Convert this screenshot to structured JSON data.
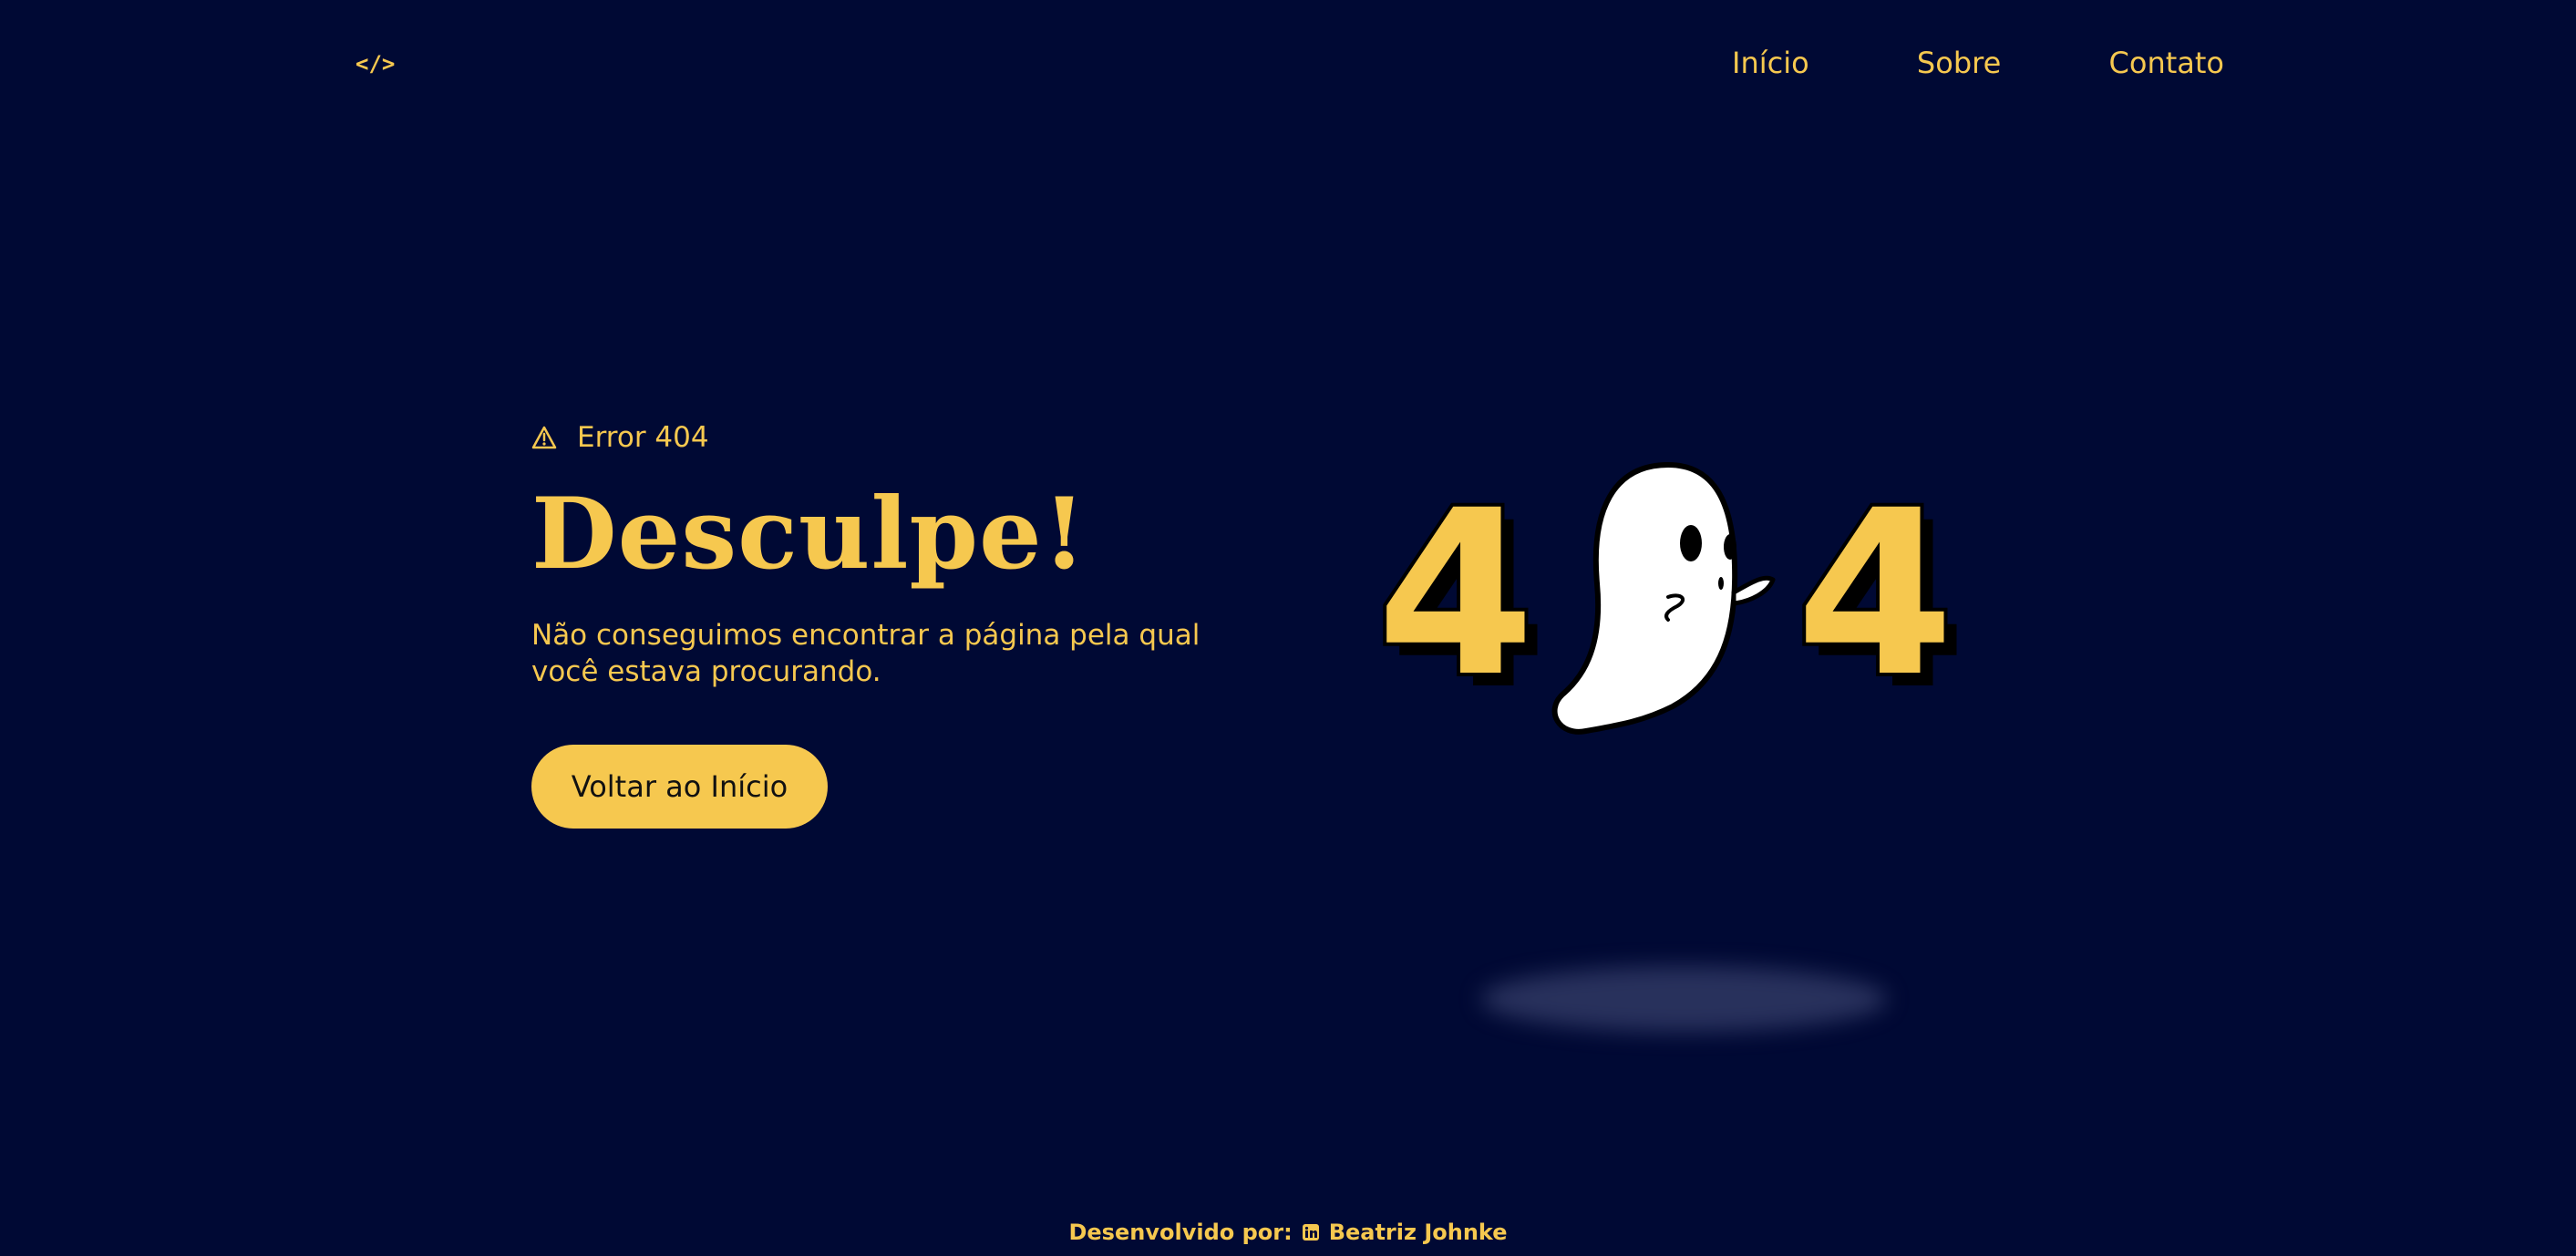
{
  "logo": {
    "text": "</>"
  },
  "nav": {
    "items": [
      "Início",
      "Sobre",
      "Contato"
    ]
  },
  "error": {
    "label": "Error 404"
  },
  "hero": {
    "headline": "Desculpe!",
    "description": "Não conseguimos encontrar a página pela qual você estava procurando.",
    "button": "Voltar ao Início"
  },
  "illustration": {
    "left_digit": "4",
    "right_digit": "4"
  },
  "footer": {
    "prefix": "Desenvolvido por:",
    "author": "Beatriz Johnke"
  },
  "colors": {
    "background": "#000934",
    "accent": "#f6c84f",
    "button_text": "#111111",
    "ghost": "#ffffff",
    "outline": "#000000"
  },
  "icons": {
    "warning": "warning-icon",
    "linkedin": "linkedin-icon",
    "ghost": "ghost-icon"
  }
}
